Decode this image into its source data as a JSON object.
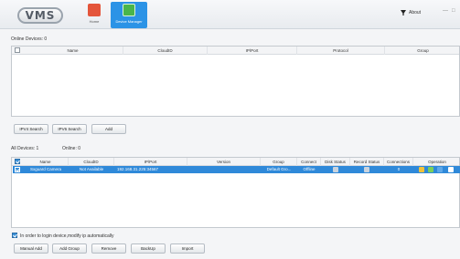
{
  "header": {
    "logo": "VMS",
    "nav": [
      {
        "label": "Home"
      },
      {
        "label": "Device Manager"
      }
    ],
    "about": "About",
    "window_buttons": [
      "—",
      "□"
    ]
  },
  "online": {
    "title": "Online Devices:  0",
    "columns": [
      "Name",
      "CloudID",
      "IP/Port",
      "Protocol",
      "Group"
    ],
    "buttons": {
      "ipv4": "IPV4 Search",
      "ipv6": "IPV6 Search",
      "add": "Add"
    }
  },
  "all": {
    "total_label": "All Devices:  1",
    "online_label": "Online:  0",
    "columns": [
      "Name",
      "CloudID",
      "IP/Port",
      "Version",
      "Group",
      "Connect",
      "Disk Status",
      "Record Status",
      "Connections",
      "Operation"
    ],
    "rows": [
      {
        "checked": true,
        "name": "Sxguard Camera",
        "cloudid": "Not Available",
        "ipport": "192.168.31.225:34567",
        "version": "",
        "group": "Default Gro...",
        "connect": "Offline",
        "connections": "0"
      }
    ]
  },
  "footer": {
    "auto_modify_label": "In order to login device,modify ip automatically",
    "auto_modify_checked": true,
    "buttons": [
      "Manual Add",
      "Add Group",
      "Remove",
      "BackUp",
      "Import"
    ]
  },
  "colors": {
    "accent": "#2f89d9",
    "home_icon": "#e4553b",
    "device_icon": "#49b54b"
  }
}
